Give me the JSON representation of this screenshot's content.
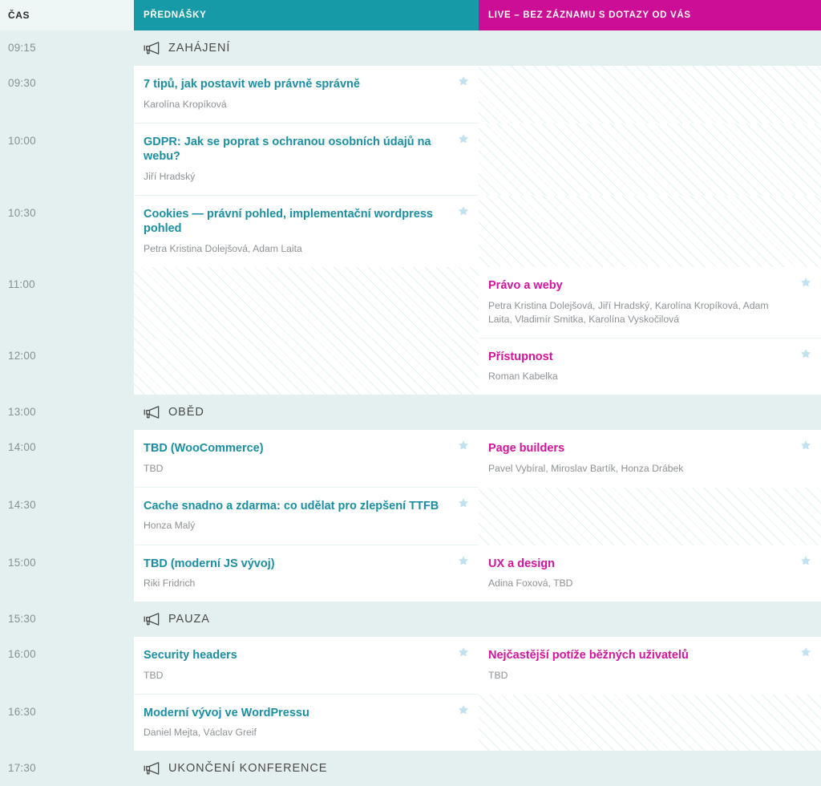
{
  "header": {
    "time_label": "ČAS",
    "talks_label": "PŘEDNÁŠKY",
    "live_label": "LIVE – BEZ ZÁZNAMU S DOTAZY OD VÁS",
    "talks_color": "#179aa8",
    "live_color": "#cc0d96"
  },
  "icons": {
    "megaphone": "megaphone-icon",
    "star": "star-icon"
  },
  "rows": [
    {
      "type": "break",
      "time": "09:15",
      "label": "ZAHÁJENÍ"
    },
    {
      "type": "session",
      "time": "09:30",
      "talks": {
        "title": "7 tipů, jak postavit web právně správně",
        "speakers": "Karolína Kropíková",
        "starred": true
      },
      "live": null
    },
    {
      "type": "session",
      "time": "10:00",
      "talks": {
        "title": "GDPR: Jak se poprat s ochranou osobních údajů na webu?",
        "speakers": "Jiří Hradský",
        "starred": true
      },
      "live": null
    },
    {
      "type": "session",
      "time": "10:30",
      "talks": {
        "title": "Cookies — právní pohled, implementační wordpress pohled",
        "speakers": "Petra Kristina Dolejšová, Adam Laita",
        "starred": true
      },
      "live": null
    },
    {
      "type": "session",
      "time": "11:00",
      "talks": null,
      "live": {
        "title": "Právo a weby",
        "speakers": "Petra Kristina Dolejšová, Jiří Hradský, Karolína Kropíková, Adam Laita, Vladimír Smitka, Karolína Vyskočilová",
        "starred": true
      }
    },
    {
      "type": "session",
      "time": "12:00",
      "talks": null,
      "live": {
        "title": "Přístupnost",
        "speakers": "Roman Kabelka",
        "starred": true
      }
    },
    {
      "type": "break",
      "time": "13:00",
      "label": "OBĚD"
    },
    {
      "type": "session",
      "time": "14:00",
      "talks": {
        "title": "TBD (WooCommerce)",
        "speakers": "TBD",
        "starred": true
      },
      "live": {
        "title": "Page builders",
        "speakers": "Pavel Vybíral, Miroslav Bartík, Honza Drábek",
        "starred": true
      }
    },
    {
      "type": "session",
      "time": "14:30",
      "talks": {
        "title": "Cache snadno a zdarma: co udělat pro zlepšení TTFB",
        "speakers": "Honza Malý",
        "starred": true
      },
      "live": null
    },
    {
      "type": "session",
      "time": "15:00",
      "talks": {
        "title": "TBD (moderní JS vývoj)",
        "speakers": "Riki Fridrich",
        "starred": true
      },
      "live": {
        "title": "UX a design",
        "speakers": "Adina Foxová, TBD",
        "starred": true
      }
    },
    {
      "type": "break",
      "time": "15:30",
      "label": "PAUZA"
    },
    {
      "type": "session",
      "time": "16:00",
      "talks": {
        "title": "Security headers",
        "speakers": "TBD",
        "starred": true
      },
      "live": {
        "title": "Nejčastější potíže běžných uživatelů",
        "speakers": "TBD",
        "starred": true
      }
    },
    {
      "type": "session",
      "time": "16:30",
      "talks": {
        "title": "Moderní vývoj ve WordPressu",
        "speakers": "Daniel Mejta, Václav Greif",
        "starred": true
      },
      "live": null
    },
    {
      "type": "break",
      "time": "17:30",
      "label": "UKONČENÍ KONFERENCE"
    }
  ]
}
